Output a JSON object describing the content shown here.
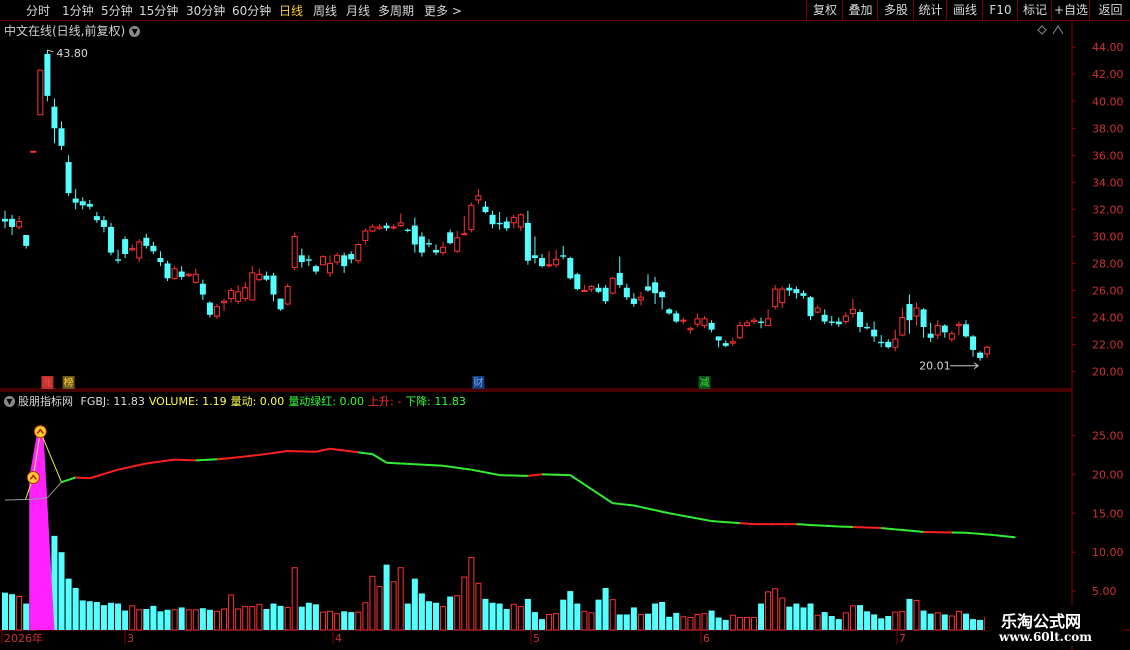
{
  "toolbar": {
    "periods": [
      "分时",
      "1分钟",
      "5分钟",
      "15分钟",
      "30分钟",
      "60分钟",
      "日线",
      "周线",
      "月线",
      "多周期",
      "更多"
    ],
    "active_period": "日线",
    "right_buttons": [
      "复权",
      "叠加",
      "多股",
      "统计",
      "画线",
      "F10",
      "标记",
      "+自选",
      "返回"
    ]
  },
  "chart": {
    "title": "中文在线(日线,前复权)",
    "high_label": "43.80",
    "low_label": "20.01",
    "price_axis": [
      "44.00",
      "42.00",
      "40.00",
      "38.00",
      "36.00",
      "34.00",
      "32.00",
      "30.00",
      "28.00",
      "26.00",
      "24.00",
      "22.00",
      "20.00"
    ],
    "event_markers": [
      {
        "text": "涨",
        "color": "#ff4444"
      },
      {
        "text": "榜",
        "color": "#ffcc33"
      },
      {
        "text": "财",
        "color": "#66aaff"
      },
      {
        "text": "减",
        "color": "#33dd33"
      }
    ],
    "date_axis": [
      "2026年",
      "3",
      "4",
      "5",
      "6",
      "7"
    ]
  },
  "indicator": {
    "name": "股朋指标网",
    "items": [
      {
        "label": "FGBJ: 11.83",
        "color": "#dddddd"
      },
      {
        "label": "VOLUME: 1.19",
        "color": "#ffff44"
      },
      {
        "label": "量动: 0.00",
        "color": "#ffff44"
      },
      {
        "label": "量动绿红: 0.00",
        "color": "#33ff33"
      },
      {
        "label": "上升: -",
        "color": "#ff3333"
      },
      {
        "label": "下降: 11.83",
        "color": "#33ff33"
      }
    ],
    "axis": [
      "25.00",
      "20.00",
      "15.00",
      "10.00",
      "5.00"
    ]
  },
  "watermark": {
    "line1": "乐淘公式网",
    "line2": "www.60lt.com"
  },
  "colors": {
    "up": "#ff3232",
    "down": "#54ffff",
    "line_up": "#ff2020",
    "line_down": "#33ee33",
    "spike": "#ff22ff",
    "frame": "#8b0000"
  },
  "chart_data": {
    "type": "candlestick",
    "candles": [
      [
        31.3,
        31.1,
        31.9,
        30.6
      ],
      [
        31.3,
        30.7,
        31.6,
        30.1
      ],
      [
        30.7,
        31.1,
        31.5,
        30.5
      ],
      [
        30.1,
        29.3,
        30.1,
        29.1
      ],
      [
        36.3,
        36.3,
        36.3,
        36.3
      ],
      [
        39.0,
        42.3,
        42.3,
        39.0
      ],
      [
        43.5,
        40.4,
        43.8,
        40.0
      ],
      [
        39.6,
        38.0,
        40.2,
        36.9
      ],
      [
        38.0,
        36.7,
        38.5,
        36.4
      ],
      [
        35.5,
        33.2,
        36.0,
        33.0
      ],
      [
        32.8,
        32.5,
        33.5,
        32.0
      ],
      [
        32.6,
        32.3,
        32.9,
        32.0
      ],
      [
        32.4,
        32.2,
        32.7,
        32.0
      ],
      [
        31.5,
        31.2,
        31.8,
        31.0
      ],
      [
        31.2,
        30.7,
        31.5,
        30.3
      ],
      [
        30.7,
        28.8,
        31.0,
        28.6
      ],
      [
        28.3,
        28.2,
        29.0,
        28.0
      ],
      [
        29.8,
        28.7,
        30.0,
        28.4
      ],
      [
        29.0,
        29.1,
        29.4,
        28.9
      ],
      [
        28.4,
        29.6,
        29.8,
        28.1
      ],
      [
        29.9,
        29.3,
        30.2,
        29.1
      ],
      [
        29.3,
        28.9,
        29.6,
        28.7
      ],
      [
        28.4,
        28.1,
        28.9,
        27.8
      ],
      [
        28.0,
        26.9,
        28.2,
        26.7
      ],
      [
        26.9,
        27.6,
        27.8,
        26.8
      ],
      [
        27.4,
        27.0,
        27.8,
        26.8
      ],
      [
        27.1,
        27.2,
        27.3,
        27.0
      ],
      [
        26.6,
        27.2,
        27.6,
        26.5
      ],
      [
        26.5,
        25.7,
        26.8,
        25.3
      ],
      [
        25.1,
        24.2,
        25.2,
        24.0
      ],
      [
        24.1,
        24.8,
        25.0,
        23.9
      ],
      [
        25.1,
        25.2,
        25.4,
        24.5
      ],
      [
        25.4,
        26.0,
        26.2,
        25.1
      ],
      [
        25.2,
        25.9,
        26.4,
        25.0
      ],
      [
        25.4,
        26.2,
        26.6,
        25.2
      ],
      [
        25.3,
        27.3,
        27.8,
        25.3
      ],
      [
        26.8,
        27.2,
        27.6,
        26.7
      ],
      [
        27.1,
        26.8,
        27.4,
        26.7
      ],
      [
        27.1,
        25.7,
        27.3,
        25.2
      ],
      [
        25.4,
        24.6,
        25.4,
        24.5
      ],
      [
        25.0,
        26.3,
        26.5,
        24.9
      ],
      [
        27.7,
        30.0,
        30.3,
        27.5
      ],
      [
        28.6,
        28.1,
        29.1,
        27.7
      ],
      [
        28.3,
        28.2,
        28.6,
        27.8
      ],
      [
        27.8,
        27.4,
        27.9,
        27.2
      ],
      [
        27.9,
        28.5,
        28.6,
        27.9
      ],
      [
        27.3,
        28.0,
        28.6,
        27.0
      ],
      [
        28.1,
        28.6,
        28.8,
        27.9
      ],
      [
        28.6,
        27.8,
        28.8,
        27.3
      ],
      [
        28.7,
        28.3,
        28.9,
        28.0
      ],
      [
        28.2,
        29.4,
        29.5,
        28.0
      ],
      [
        29.7,
        30.4,
        30.6,
        29.4
      ],
      [
        30.4,
        30.7,
        30.9,
        30.3
      ],
      [
        30.6,
        30.7,
        30.9,
        30.5
      ],
      [
        30.8,
        30.6,
        31.0,
        30.4
      ],
      [
        30.7,
        30.7,
        30.9,
        30.5
      ],
      [
        30.8,
        31.0,
        31.7,
        30.7
      ],
      [
        30.5,
        30.4,
        30.6,
        30.3
      ],
      [
        30.8,
        29.4,
        31.4,
        28.8
      ],
      [
        30.0,
        28.8,
        30.3,
        28.5
      ],
      [
        29.5,
        29.4,
        29.8,
        29.2
      ],
      [
        29.0,
        28.8,
        29.4,
        28.6
      ],
      [
        28.8,
        29.2,
        29.6,
        28.6
      ],
      [
        30.3,
        29.5,
        30.5,
        29.4
      ],
      [
        28.9,
        29.9,
        30.4,
        28.8
      ],
      [
        30.2,
        30.2,
        31.5,
        30.1
      ],
      [
        30.5,
        32.3,
        32.5,
        30.3
      ],
      [
        32.7,
        33.0,
        33.5,
        32.4
      ],
      [
        32.2,
        31.8,
        32.6,
        31.7
      ],
      [
        31.6,
        30.9,
        31.9,
        30.6
      ],
      [
        31.0,
        30.9,
        31.8,
        30.5
      ],
      [
        31.1,
        30.6,
        31.4,
        30.4
      ],
      [
        31.0,
        31.4,
        31.6,
        30.6
      ],
      [
        30.7,
        31.6,
        31.7,
        30.4
      ],
      [
        31.0,
        28.2,
        31.9,
        27.9
      ],
      [
        28.6,
        28.4,
        30.0,
        28.0
      ],
      [
        28.4,
        27.8,
        28.7,
        27.7
      ],
      [
        27.9,
        27.9,
        28.9,
        27.7
      ],
      [
        27.9,
        28.3,
        29.0,
        27.7
      ],
      [
        28.6,
        28.5,
        29.3,
        28.3
      ],
      [
        28.4,
        26.9,
        28.5,
        26.8
      ],
      [
        27.2,
        26.1,
        27.3,
        26.0
      ],
      [
        26.0,
        26.0,
        26.4,
        25.9
      ],
      [
        26.1,
        26.3,
        26.4,
        25.9
      ],
      [
        26.2,
        25.9,
        26.5,
        25.8
      ],
      [
        26.2,
        25.2,
        26.4,
        25.0
      ],
      [
        25.8,
        26.9,
        27.0,
        25.7
      ],
      [
        27.3,
        26.4,
        28.5,
        26.2
      ],
      [
        26.2,
        25.5,
        26.5,
        25.3
      ],
      [
        25.4,
        25.0,
        25.8,
        24.8
      ],
      [
        25.3,
        25.5,
        25.9,
        24.9
      ],
      [
        26.3,
        26.0,
        27.2,
        25.9
      ],
      [
        26.6,
        25.8,
        27.0,
        25.0
      ],
      [
        25.9,
        25.5,
        26.0,
        24.6
      ],
      [
        24.6,
        24.3,
        24.7,
        24.2
      ],
      [
        24.3,
        23.7,
        24.5,
        23.6
      ],
      [
        23.8,
        23.8,
        24.0,
        23.5
      ],
      [
        23.1,
        23.2,
        23.3,
        22.8
      ],
      [
        23.5,
        23.9,
        24.3,
        23.3
      ],
      [
        23.4,
        23.9,
        24.1,
        23.2
      ],
      [
        23.6,
        23.1,
        23.8,
        22.9
      ],
      [
        22.6,
        22.3,
        22.6,
        21.8
      ],
      [
        22.1,
        21.9,
        22.3,
        21.8
      ],
      [
        22.1,
        22.2,
        22.5,
        21.9
      ],
      [
        22.5,
        23.4,
        23.7,
        22.4
      ],
      [
        23.4,
        23.6,
        23.8,
        23.3
      ],
      [
        23.7,
        23.8,
        24.0,
        23.5
      ],
      [
        23.7,
        23.6,
        24.0,
        23.2
      ],
      [
        23.4,
        23.9,
        24.6,
        23.4
      ],
      [
        24.8,
        26.1,
        26.4,
        24.6
      ],
      [
        25.1,
        26.1,
        26.3,
        24.7
      ],
      [
        26.2,
        26.0,
        26.5,
        25.6
      ],
      [
        26.1,
        25.8,
        26.3,
        25.4
      ],
      [
        25.8,
        25.6,
        26.0,
        25.4
      ],
      [
        25.5,
        24.1,
        25.6,
        23.8
      ],
      [
        24.4,
        24.7,
        24.9,
        24.3
      ],
      [
        24.2,
        23.7,
        24.6,
        23.5
      ],
      [
        23.7,
        23.6,
        24.1,
        23.4
      ],
      [
        23.7,
        23.5,
        24.0,
        23.3
      ],
      [
        23.7,
        24.1,
        24.4,
        23.5
      ],
      [
        24.3,
        24.6,
        25.4,
        24.0
      ],
      [
        24.4,
        23.3,
        24.6,
        22.9
      ],
      [
        23.3,
        23.2,
        23.6,
        23.1
      ],
      [
        23.1,
        22.6,
        23.7,
        22.2
      ],
      [
        22.2,
        22.1,
        22.7,
        21.8
      ],
      [
        22.2,
        21.8,
        22.4,
        21.7
      ],
      [
        21.8,
        22.4,
        23.1,
        21.5
      ],
      [
        22.7,
        24.0,
        24.7,
        22.6
      ],
      [
        25.0,
        23.8,
        25.7,
        22.8
      ],
      [
        24.1,
        24.7,
        25.1,
        23.4
      ],
      [
        24.6,
        23.3,
        24.7,
        22.5
      ],
      [
        22.8,
        22.5,
        23.6,
        22.2
      ],
      [
        22.7,
        23.4,
        23.8,
        22.4
      ],
      [
        23.4,
        22.9,
        23.5,
        22.5
      ],
      [
        22.4,
        22.8,
        23.0,
        22.2
      ],
      [
        23.4,
        23.5,
        23.7,
        22.7
      ],
      [
        23.5,
        22.6,
        23.8,
        22.5
      ],
      [
        22.6,
        21.6,
        22.7,
        21.1
      ],
      [
        21.4,
        21.0,
        21.5,
        20.8
      ],
      [
        21.3,
        21.8,
        21.9,
        21.0
      ]
    ],
    "price_range": [
      19.3,
      45.2
    ],
    "volume_heights": [
      4.8,
      4.6,
      4.3,
      3.4,
      3.1,
      26.2,
      26.5,
      12.1,
      10.0,
      6.6,
      5.4,
      3.8,
      3.7,
      3.6,
      3.2,
      3.5,
      3.4,
      2.5,
      3.1,
      2.6,
      2.7,
      3.1,
      2.4,
      2.6,
      2.6,
      2.9,
      2.6,
      2.6,
      2.8,
      2.6,
      2.4,
      2.7,
      4.5,
      2.7,
      3.0,
      3.0,
      3.3,
      2.7,
      3.4,
      3.1,
      2.9,
      8.0,
      3.0,
      3.5,
      3.3,
      2.3,
      2.4,
      2.1,
      2.4,
      2.3,
      2.3,
      3.5,
      6.9,
      5.6,
      8.4,
      6.2,
      8.0,
      3.4,
      6.6,
      4.7,
      3.7,
      3.5,
      3.0,
      4.3,
      4.4,
      6.8,
      9.3,
      6.0,
      4.0,
      3.5,
      3.4,
      2.7,
      3.3,
      3.0,
      4.0,
      2.3,
      1.4,
      2.0,
      2.1,
      3.9,
      5.0,
      3.4,
      2.4,
      2.2,
      3.9,
      5.4,
      3.9,
      2.0,
      2.0,
      2.9,
      2.0,
      2.1,
      3.4,
      3.6,
      1.7,
      2.2,
      1.7,
      1.6,
      2.0,
      2.1,
      2.5,
      1.6,
      1.3,
      1.9,
      1.6,
      1.6,
      1.6,
      3.4,
      4.9,
      5.3,
      4.1,
      3.0,
      3.4,
      2.9,
      3.4,
      1.9,
      2.3,
      1.8,
      1.4,
      2.2,
      3.1,
      3.2,
      2.4,
      2.0,
      1.5,
      1.8,
      2.3,
      2.4,
      4.0,
      3.8,
      2.5,
      2.1,
      2.2,
      2.0,
      1.8,
      2.4,
      2.1,
      1.4,
      1.3,
      1.6
    ],
    "fgbj_line": [
      [
        0,
        16.7
      ],
      [
        4,
        16.8
      ],
      [
        6,
        17.0
      ],
      [
        8,
        19.0
      ],
      [
        10,
        19.6
      ],
      [
        12,
        19.5
      ],
      [
        16,
        20.6
      ],
      [
        20,
        21.4
      ],
      [
        24,
        21.9
      ],
      [
        27,
        21.8
      ],
      [
        31,
        22.0
      ],
      [
        36,
        22.5
      ],
      [
        40,
        23.0
      ],
      [
        44,
        22.9
      ],
      [
        46,
        23.3
      ],
      [
        52,
        22.6
      ],
      [
        54,
        21.5
      ],
      [
        62,
        21.1
      ],
      [
        66,
        20.6
      ],
      [
        70,
        19.9
      ],
      [
        74,
        19.8
      ],
      [
        76,
        20.0
      ],
      [
        80,
        19.9
      ],
      [
        86,
        16.3
      ],
      [
        89,
        16.0
      ],
      [
        94,
        15.0
      ],
      [
        100,
        14.0
      ],
      [
        106,
        13.6
      ],
      [
        112,
        13.6
      ],
      [
        118,
        13.3
      ],
      [
        124,
        13.1
      ],
      [
        130,
        12.6
      ],
      [
        136,
        12.5
      ],
      [
        140,
        12.2
      ],
      [
        143,
        11.9
      ]
    ],
    "fgbj_up_segments": [
      [
        10,
        27
      ],
      [
        30,
        50
      ],
      [
        74,
        76
      ],
      [
        104,
        112
      ],
      [
        120,
        124
      ],
      [
        130,
        134
      ]
    ],
    "fgbj_points": [
      [
        4,
        19.6
      ],
      [
        5,
        25.5
      ]
    ]
  }
}
